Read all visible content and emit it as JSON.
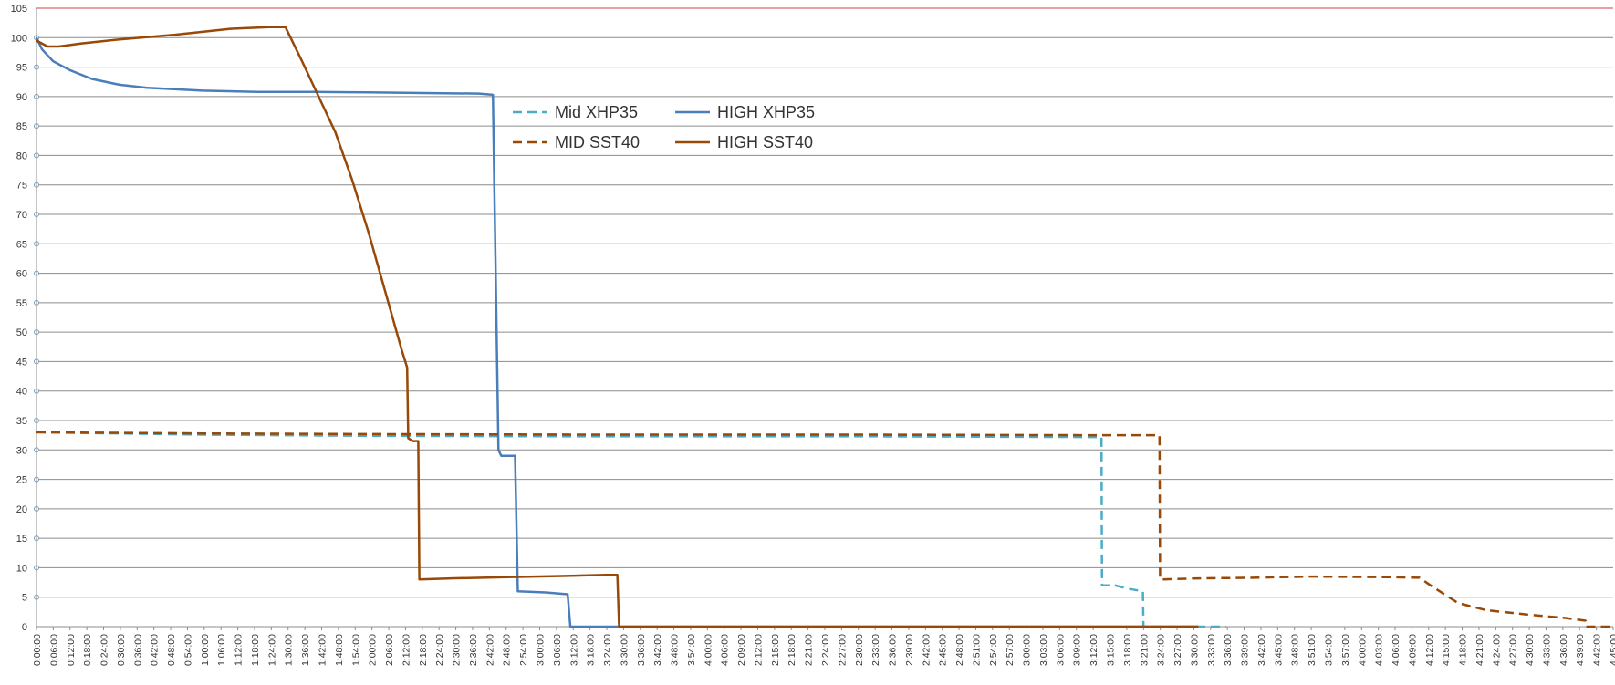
{
  "chart_data": {
    "type": "line",
    "title": "",
    "xlabel": "",
    "ylabel": "",
    "ylim": [
      0,
      105
    ],
    "yticks": [
      0,
      5,
      10,
      15,
      20,
      25,
      30,
      35,
      40,
      45,
      50,
      55,
      60,
      65,
      70,
      75,
      80,
      85,
      90,
      95,
      100,
      105
    ],
    "xlim_minutes": [
      0,
      285
    ],
    "x_tick_labels": [
      "0:00:00",
      "0:06:00",
      "0:12:00",
      "0:18:00",
      "0:24:00",
      "0:30:00",
      "0:36:00",
      "0:42:00",
      "0:48:00",
      "0:54:00",
      "1:00:00",
      "1:06:00",
      "1:12:00",
      "1:18:00",
      "1:24:00",
      "1:30:00",
      "1:36:00",
      "1:42:00",
      "1:48:00",
      "1:54:00",
      "2:00:00",
      "2:06:00",
      "2:12:00",
      "2:18:00",
      "2:24:00",
      "2:30:00",
      "2:36:00",
      "2:42:00",
      "2:48:00",
      "2:54:00",
      "3:00:00",
      "3:06:00",
      "3:12:00",
      "3:18:00",
      "3:24:00",
      "3:30:00",
      "3:36:00",
      "3:42:00",
      "3:48:00",
      "3:54:00",
      "4:00:00",
      "4:06:00",
      "2:09:00",
      "2:12:00",
      "2:15:00",
      "2:18:00",
      "2:21:00",
      "2:24:00",
      "2:27:00",
      "2:30:00",
      "2:33:00",
      "2:36:00",
      "2:39:00",
      "2:42:00",
      "2:45:00",
      "2:48:00",
      "2:51:00",
      "2:54:00",
      "2:57:00",
      "3:00:00",
      "3:03:00",
      "3:06:00",
      "3:09:00",
      "3:12:00",
      "3:15:00",
      "3:18:00",
      "3:21:00",
      "3:24:00",
      "3:27:00",
      "3:30:00",
      "3:33:00",
      "3:36:00",
      "3:39:00",
      "3:42:00",
      "3:45:00",
      "3:48:00",
      "3:51:00",
      "3:54:00",
      "3:57:00",
      "4:00:00",
      "4:03:00",
      "4:06:00",
      "4:09:00",
      "4:12:00",
      "4:15:00",
      "4:18:00",
      "4:21:00",
      "4:24:00",
      "4:27:00",
      "4:30:00",
      "4:33:00",
      "4:36:00",
      "4:39:00",
      "4:42:00",
      "4:45:00"
    ],
    "grid": true,
    "legend_position": "top-center",
    "series": [
      {
        "name": "Mid XHP35",
        "color": "#4bacc6",
        "style": "dashed",
        "points": [
          [
            0,
            33
          ],
          [
            30,
            32.6
          ],
          [
            60,
            32.4
          ],
          [
            100,
            32.3
          ],
          [
            150,
            32.3
          ],
          [
            190,
            32.2
          ],
          [
            192.5,
            32.2
          ],
          [
            192.6,
            7
          ],
          [
            195,
            7
          ],
          [
            197,
            6.5
          ],
          [
            200,
            6
          ],
          [
            200.1,
            0
          ],
          [
            215,
            0
          ]
        ]
      },
      {
        "name": "HIGH XHP35",
        "color": "#4a7ebb",
        "style": "solid",
        "points": [
          [
            0,
            100
          ],
          [
            1,
            98
          ],
          [
            3,
            96
          ],
          [
            6,
            94.5
          ],
          [
            10,
            93
          ],
          [
            15,
            92
          ],
          [
            20,
            91.5
          ],
          [
            30,
            91
          ],
          [
            40,
            90.8
          ],
          [
            50,
            90.8
          ],
          [
            60,
            90.7
          ],
          [
            70,
            90.6
          ],
          [
            80,
            90.5
          ],
          [
            82.5,
            90.3
          ],
          [
            83.5,
            30
          ],
          [
            84,
            29
          ],
          [
            86.5,
            29
          ],
          [
            87,
            6
          ],
          [
            92,
            5.8
          ],
          [
            96,
            5.5
          ],
          [
            96.5,
            0
          ],
          [
            210,
            0
          ]
        ]
      },
      {
        "name": "MID SST40",
        "color": "#984807",
        "style": "dashed",
        "points": [
          [
            0,
            33
          ],
          [
            30,
            32.8
          ],
          [
            60,
            32.7
          ],
          [
            100,
            32.6
          ],
          [
            150,
            32.6
          ],
          [
            190,
            32.5
          ],
          [
            203,
            32.5
          ],
          [
            203.1,
            8
          ],
          [
            210,
            8.2
          ],
          [
            220,
            8.3
          ],
          [
            230,
            8.5
          ],
          [
            245,
            8.4
          ],
          [
            250,
            8.3
          ],
          [
            252,
            7
          ],
          [
            257,
            4
          ],
          [
            262,
            2.8
          ],
          [
            270,
            2
          ],
          [
            276,
            1.5
          ],
          [
            280,
            1
          ],
          [
            280.1,
            0
          ],
          [
            285,
            0
          ]
        ]
      },
      {
        "name": "HIGH SST40",
        "color": "#984807",
        "style": "solid",
        "points": [
          [
            0,
            99.5
          ],
          [
            2,
            98.5
          ],
          [
            4,
            98.5
          ],
          [
            8,
            99
          ],
          [
            15,
            99.7
          ],
          [
            25,
            100.5
          ],
          [
            35,
            101.5
          ],
          [
            42,
            101.8
          ],
          [
            45,
            101.8
          ],
          [
            48,
            96
          ],
          [
            51,
            90
          ],
          [
            54,
            84
          ],
          [
            57,
            76
          ],
          [
            60,
            67
          ],
          [
            63,
            57
          ],
          [
            66,
            47
          ],
          [
            67,
            44
          ],
          [
            67.2,
            32
          ],
          [
            68,
            31.5
          ],
          [
            69,
            31.5
          ],
          [
            69.2,
            8
          ],
          [
            75,
            8.2
          ],
          [
            85,
            8.4
          ],
          [
            95,
            8.6
          ],
          [
            103,
            8.8
          ],
          [
            105,
            8.8
          ],
          [
            105.3,
            0
          ],
          [
            210,
            0
          ]
        ]
      }
    ]
  }
}
